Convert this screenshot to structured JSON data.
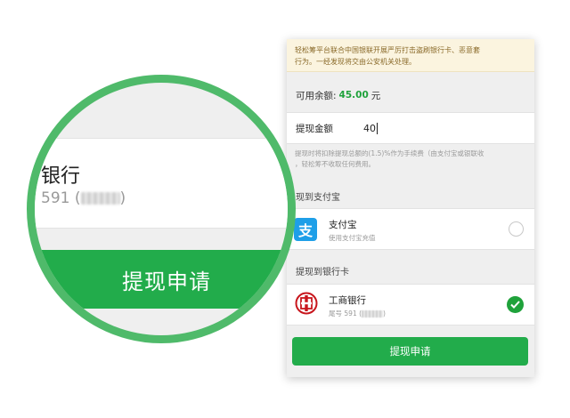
{
  "warning": {
    "line1": "轻松筹平台联合中国银联开展严厉打击盗刷银行卡、恶意套",
    "line2": "行为。一经发现将交由公安机关处理。"
  },
  "balance": {
    "label": "可用余额:",
    "amount": "45.00",
    "unit": "元"
  },
  "withdraw": {
    "label": "提现金额",
    "value": "40"
  },
  "fee_note": {
    "line1": "提现时将扣除提现总额的(1.5)%作为手续费（由支付宝或银联收",
    "line2": "，轻松筹不收取任何费用。"
  },
  "alipay_section": {
    "title": "现到支付宝"
  },
  "alipay": {
    "name": "支付宝",
    "subtitle": "使用支付宝充值",
    "icon": "alipay-icon",
    "selected": false
  },
  "bank_section": {
    "title": "提现到银行卡"
  },
  "bank": {
    "name": "工商银行",
    "tail_prefix": "尾号 59",
    "tail_suffix": "1",
    "icon": "icbc-icon",
    "selected": true
  },
  "submit": {
    "label": "提现申请"
  },
  "magnifier": {
    "bank_text": "银行",
    "tail_text": "59",
    "tail_suffix": "1",
    "button_label": "提现申请"
  },
  "colors": {
    "accent": "#22ac4b",
    "magnifier_ring": "#4fba6a",
    "warning_bg": "#fbf4df",
    "alipay": "#1e9fe8",
    "icbc": "#c8161d"
  }
}
